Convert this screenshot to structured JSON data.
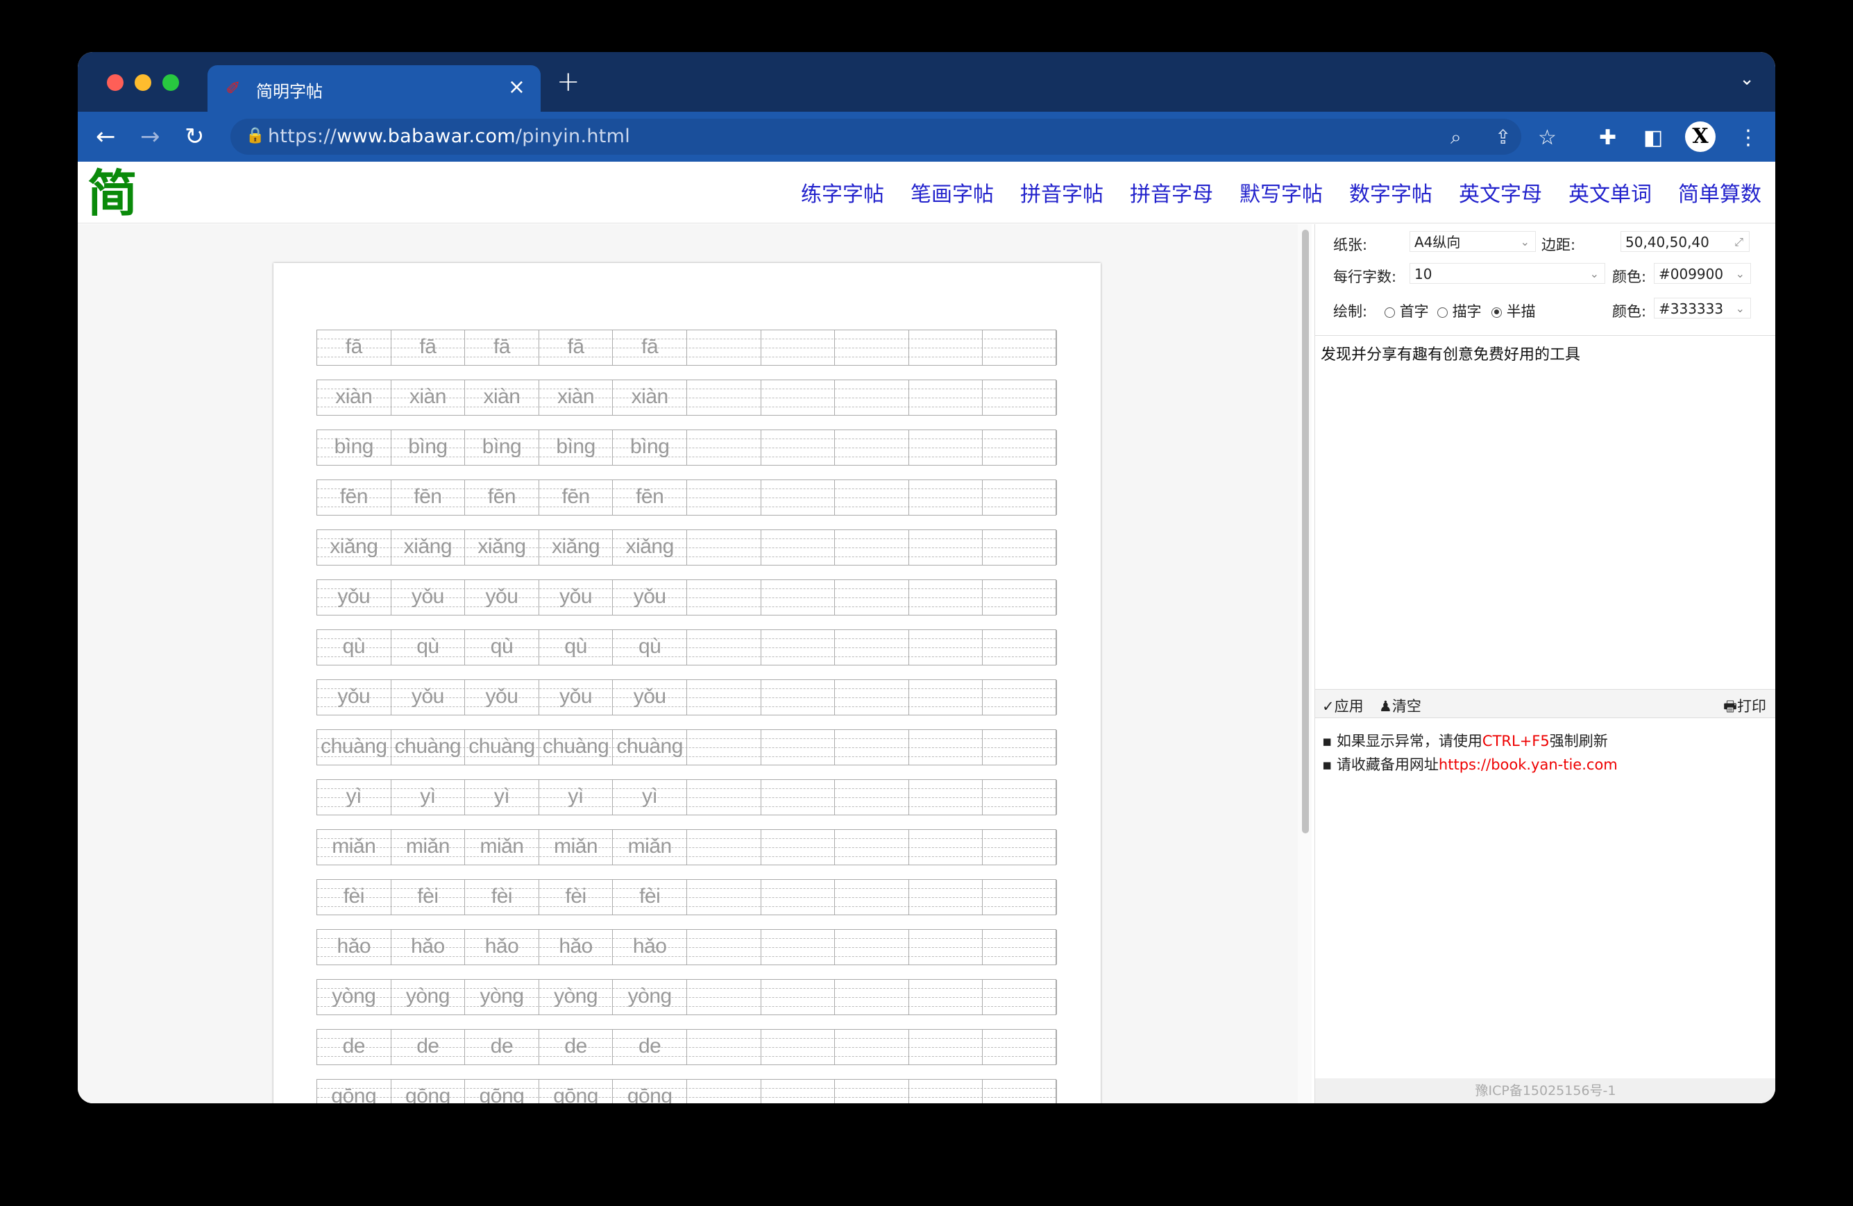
{
  "browser": {
    "tab_title": "简明字帖",
    "tab_close": "×",
    "new_tab": "+",
    "url_prefix": "https://",
    "url_domain": "www.babawar.com",
    "url_path": "/pinyin.html",
    "avatar_letter": "X"
  },
  "site": {
    "logo": "简",
    "nav": [
      "练字字帖",
      "笔画字帖",
      "拼音字帖",
      "拼音字母",
      "默写字帖",
      "数字字帖",
      "英文字母",
      "英文单词",
      "简单算数"
    ]
  },
  "sheet": {
    "rows": [
      "fā",
      "xiàn",
      "bìng",
      "fēn",
      "xiǎng",
      "yǒu",
      "qù",
      "yǒu",
      "chuàng",
      "yì",
      "miǎn",
      "fèi",
      "hǎo",
      "yòng",
      "de",
      "gōng"
    ],
    "repeat": 5,
    "columns": 10
  },
  "settings": {
    "paper_label": "纸张:",
    "paper_value": "A4纵向",
    "margin_label": "边距:",
    "margin_value": "50,40,50,40",
    "per_row_label": "每行字数:",
    "per_row_value": "10",
    "color_label": "颜色:",
    "color1_value": "#009900",
    "draw_label": "绘制:",
    "draw_options": [
      "首字",
      "描字",
      "半描"
    ],
    "color2_value": "#333333",
    "accent_colors": [
      "#009900",
      "#333333"
    ]
  },
  "content_text": "发现并分享有趣有创意免费好用的工具",
  "actions": {
    "apply": "✓应用",
    "clear": "♟清空",
    "print": "🖶打印"
  },
  "tips": {
    "tip1_prefix": "如果显示异常，请使用",
    "tip1_key": "CTRL+F5",
    "tip1_suffix": "强制刷新",
    "tip2_prefix": "请收藏备用网址",
    "tip2_link": "https://book.yan-tie.com"
  },
  "footer": "豫ICP备15025156号-1"
}
